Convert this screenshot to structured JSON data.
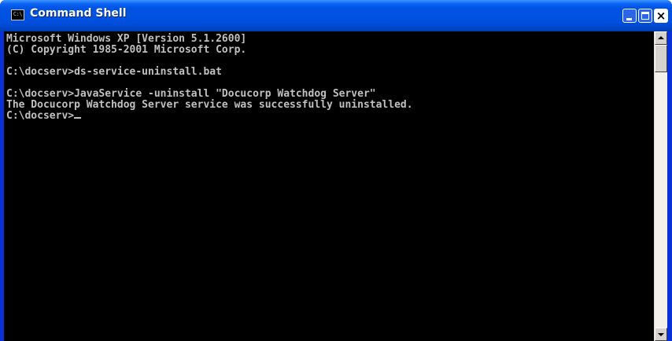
{
  "window": {
    "title": "Command Shell",
    "icon": "cmd-icon",
    "icon_label": "C:\\"
  },
  "controls": {
    "minimize": "minimize-icon",
    "maximize": "maximize-icon",
    "close": "close-icon",
    "close_glyph": "×"
  },
  "console": {
    "lines": [
      "Microsoft Windows XP [Version 5.1.2600]",
      "(C) Copyright 1985-2001 Microsoft Corp.",
      "",
      "C:\\docserv>ds-service-uninstall.bat",
      "",
      "C:\\docserv>JavaService -uninstall \"Docucorp Watchdog Server\"",
      "The Docucorp Watchdog Server service was successfully uninstalled.",
      "C:\\docserv>"
    ],
    "colors": {
      "background": "#000000",
      "text": "#c0c0c0"
    }
  },
  "scrollbar": {
    "up_icon": "scroll-up-arrow-icon",
    "down_icon": "scroll-down-arrow-icon"
  }
}
